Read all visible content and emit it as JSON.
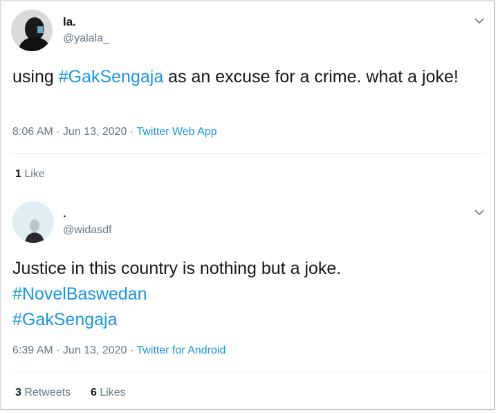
{
  "tweets": [
    {
      "display_name": "la.",
      "handle": "@yalala_",
      "text_parts": [
        "using ",
        "#GakSengaja",
        " as an excuse for a crime. what a joke!"
      ],
      "time": "8:06 AM",
      "sep1": " · ",
      "date": "Jun 13, 2020",
      "sep2": " · ",
      "source": "Twitter Web App",
      "likes_count": "1",
      "likes_label": "Like",
      "avatar_icon": "avatar-hijab-dark-icon"
    },
    {
      "display_name": ".",
      "handle": "@widasdf",
      "line1": "Justice in this country is nothing but a joke.",
      "hashtag1": "#NovelBaswedan",
      "hashtag2": "#GakSengaja",
      "time": "6:39 AM",
      "sep1": " · ",
      "date": "Jun 13, 2020",
      "sep2": " · ",
      "source": "Twitter for Android",
      "retweets_count": "3",
      "retweets_label": "Retweets",
      "likes_count": "6",
      "likes_label": "Likes",
      "avatar_icon": "avatar-hijab-light-icon"
    }
  ],
  "colors": {
    "hashtag": "#1b95e0",
    "secondary": "#657786",
    "primary_text": "#14171a",
    "divider": "#e6ecf0"
  },
  "icons": {
    "menu": "chevron-down-icon"
  }
}
